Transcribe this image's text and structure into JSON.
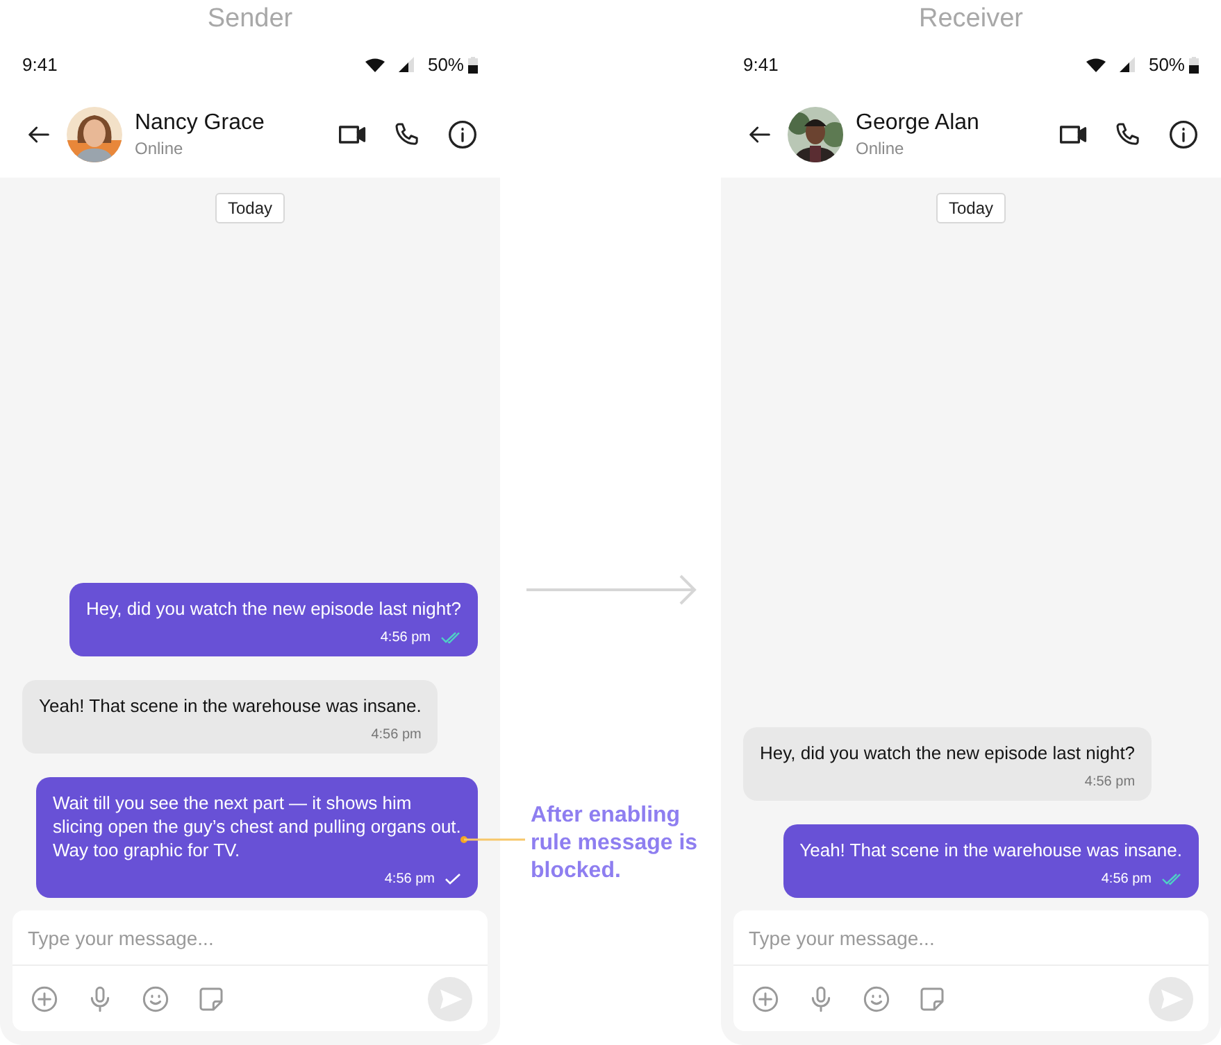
{
  "phones": [
    {
      "title": "Sender",
      "status_bar": {
        "time": "9:41",
        "battery": "50%"
      },
      "header": {
        "name": "Nancy Grace",
        "status": "Online"
      },
      "date_chip": "Today",
      "messages": [
        {
          "kind": "outgoing",
          "text": "Hey, did you watch the new episode last night?",
          "time": "4:56 pm",
          "read": true
        },
        {
          "kind": "incoming",
          "text": "Yeah! That scene in the warehouse was insane.",
          "time": "4:56 pm"
        },
        {
          "kind": "outgoing",
          "text": "Wait till you see the next part — it shows him slicing open the guy’s chest and pulling organs out. Way too graphic for TV.",
          "time": "4:56 pm",
          "read": false
        }
      ],
      "composer": {
        "placeholder": "Type your message..."
      }
    },
    {
      "title": "Receiver",
      "status_bar": {
        "time": "9:41",
        "battery": "50%"
      },
      "header": {
        "name": "George Alan",
        "status": "Online"
      },
      "date_chip": "Today",
      "messages": [
        {
          "kind": "incoming",
          "text": "Hey, did you watch the new episode last night?",
          "time": "4:56 pm"
        },
        {
          "kind": "outgoing",
          "text": "Yeah! That scene in the warehouse was insane.",
          "time": "4:56 pm",
          "read": true
        }
      ],
      "composer": {
        "placeholder": "Type your message..."
      }
    }
  ],
  "annotation": {
    "text": "After enabling rule message is blocked."
  }
}
